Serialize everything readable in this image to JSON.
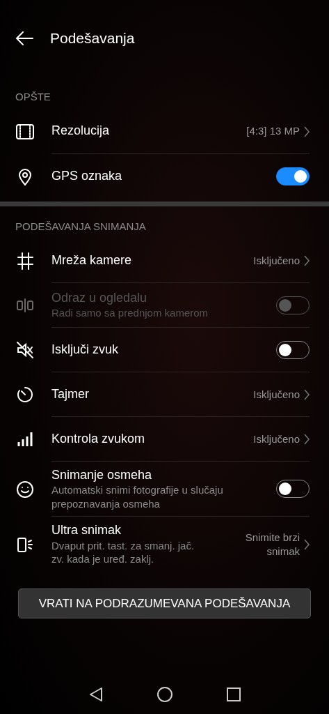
{
  "header": {
    "title": "Podešavanja"
  },
  "sections": [
    {
      "label": "OPŠTE",
      "rows": [
        {
          "kind": "link",
          "title": "Rezolucija",
          "value": "[4:3] 13 MP",
          "disabled": false
        },
        {
          "kind": "toggle",
          "title": "GPS oznaka",
          "on": true,
          "disabled": false
        }
      ]
    },
    {
      "label": "PODEŠAVANJA SNIMANJA",
      "rows": [
        {
          "kind": "link",
          "title": "Mreža kamere",
          "value": "Isključeno",
          "disabled": false
        },
        {
          "kind": "toggle",
          "title": "Odraz u ogledalu",
          "subtitle": "Radi samo sa prednjom kamerom",
          "on": false,
          "disabled": true
        },
        {
          "kind": "toggle",
          "title": "Isključi zvuk",
          "on": false,
          "disabled": false
        },
        {
          "kind": "link",
          "title": "Tajmer",
          "value": "Isključeno",
          "disabled": false
        },
        {
          "kind": "link",
          "title": "Kontrola zvukom",
          "value": "Isključeno",
          "disabled": false
        },
        {
          "kind": "toggle",
          "title": "Snimanje osmeha",
          "subtitle": "Automatski snimi fotografije u slučaju prepoznavanja osmeha",
          "on": false,
          "disabled": false
        },
        {
          "kind": "link",
          "title": "Ultra snimak",
          "subtitle": "Dvaput prit. tast. za smanj. jač. zv. kada je uređ. zaklj.",
          "value": "Snimite brzi snimak",
          "disabled": false
        }
      ]
    }
  ],
  "reset_button": "VRATI NA PODRAZUMEVANA PODEŠAVANJA"
}
